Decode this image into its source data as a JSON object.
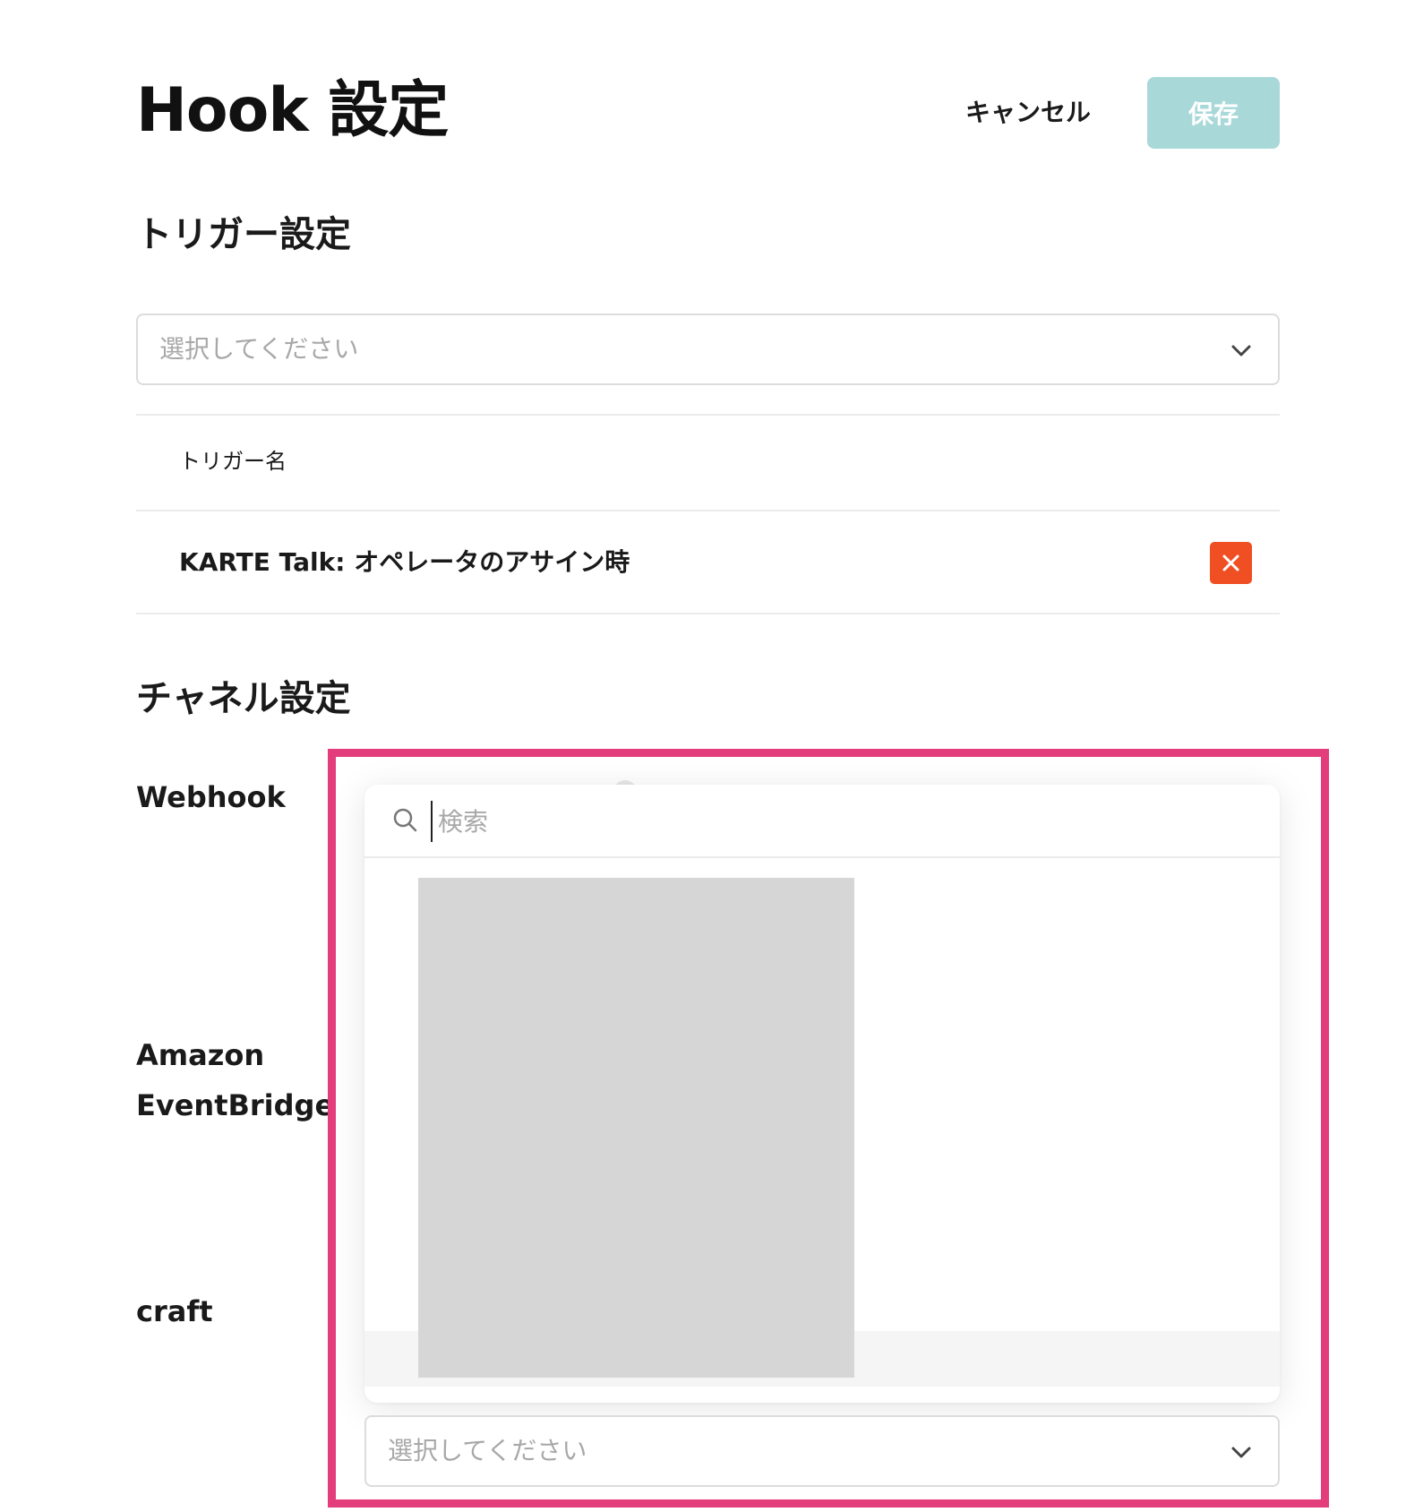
{
  "header": {
    "title": "Hook 設定",
    "cancel_label": "キャンセル",
    "save_label": "保存"
  },
  "trigger_section": {
    "heading": "トリガー設定",
    "select_placeholder": "選択してください",
    "column_header": "トリガー名",
    "triggers": [
      {
        "name": "KARTE Talk: オペレータのアサイン時"
      }
    ]
  },
  "channel_section": {
    "heading": "チャネル設定",
    "channels": [
      {
        "label": "Webhook"
      },
      {
        "label_line1": "Amazon",
        "label_line2": "EventBridge"
      },
      {
        "label": "craft"
      }
    ]
  },
  "dropdown": {
    "search_placeholder": "検索",
    "select_placeholder": "選択してください"
  },
  "colors": {
    "save_button_bg": "#a8d8d8",
    "remove_button_bg": "#f04e23",
    "highlight_frame": "#e33d7b"
  },
  "icons": {
    "select_chevron": "chevron-down-icon",
    "remove": "close-icon",
    "search": "search-icon"
  }
}
